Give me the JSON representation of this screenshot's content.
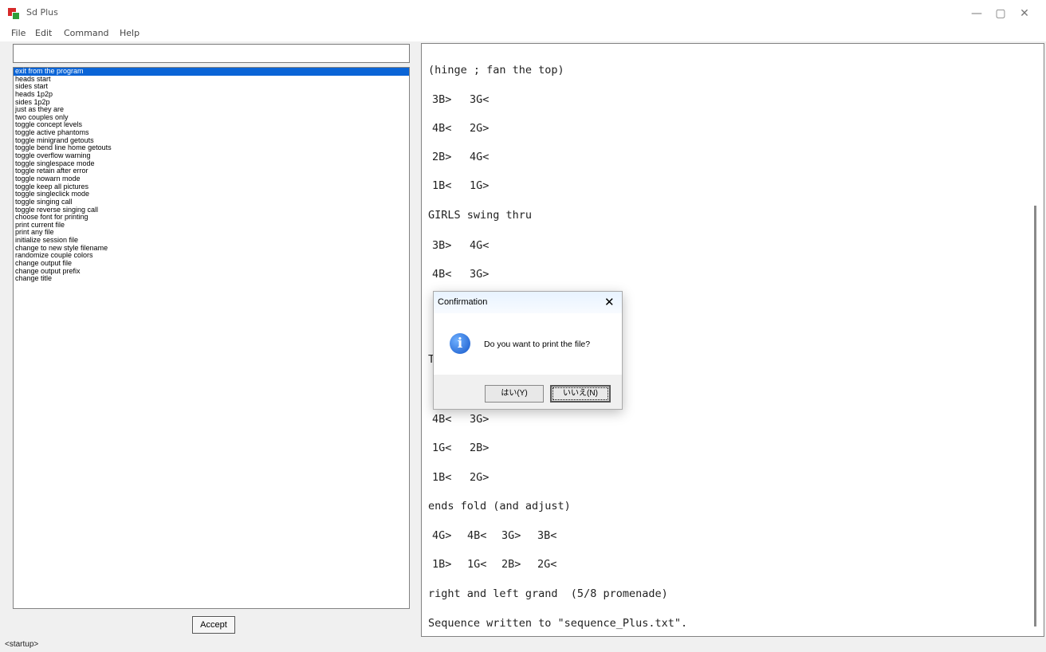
{
  "window": {
    "title": "Sd Plus",
    "controls": [
      "—",
      "▢",
      "✕"
    ]
  },
  "menu": [
    "File",
    "Edit",
    "Command",
    "Help"
  ],
  "command_input": {
    "value": ""
  },
  "command_list": [
    "exit from the program",
    "heads start",
    "sides start",
    "heads 1p2p",
    "sides 1p2p",
    "just as they are",
    "two couples only",
    "toggle concept levels",
    "toggle active phantoms",
    "toggle minigrand getouts",
    "toggle bend line home getouts",
    "toggle overflow warning",
    "toggle singlespace mode",
    "toggle retain after error",
    "toggle nowarn mode",
    "toggle keep all pictures",
    "toggle singleclick mode",
    "toggle singing call",
    "toggle reverse singing call",
    "choose font for printing",
    "print current file",
    "print any file",
    "initialize session file",
    "change to new style filename",
    "randomize couple colors",
    "change output file",
    "change output prefix",
    "change title"
  ],
  "accept_label": "Accept",
  "status": "<startup>",
  "output": {
    "lines": [
      "(hinge ; fan the top)",
      "GIRLS swing thru",
      "T",
      "ends fold (and adjust)",
      "right and left grand  (5/8 promenade)",
      "Sequence written to \"sequence_Plus.txt\"."
    ],
    "positions": [
      [
        "3B>",
        "3G<"
      ],
      [
        "4B<",
        "2G>"
      ],
      [
        "2B>",
        "4G<"
      ],
      [
        "1B<",
        "1G>"
      ],
      [
        "3B>",
        "4G<"
      ],
      [
        "4B<",
        "3G>"
      ],
      [
        "4B<",
        "3G>"
      ],
      [
        "1G<",
        "2B>"
      ],
      [
        "1B<",
        "2G>"
      ],
      [
        "4G>",
        "4B<",
        "3G>",
        "3B<"
      ],
      [
        "1B>",
        "1G<",
        "2B>",
        "2G<"
      ]
    ]
  },
  "dialog": {
    "title": "Confirmation",
    "close": "✕",
    "message": "Do you want to print the file?",
    "icon": "info-icon",
    "icon_glyph": "i",
    "yes_label": "はい(Y)",
    "no_label": "いいえ(N)"
  }
}
